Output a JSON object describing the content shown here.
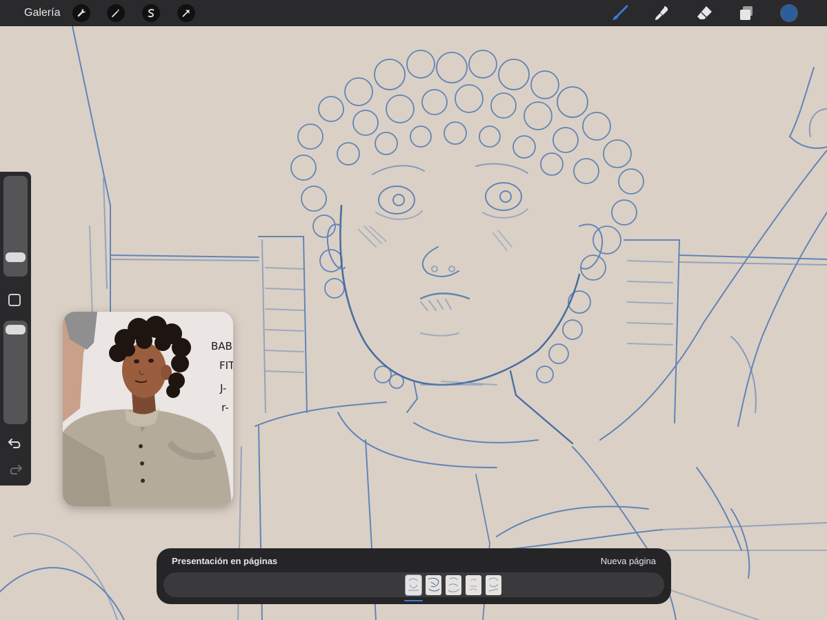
{
  "topbar": {
    "gallery_label": "Galería",
    "left_tools": [
      "wrench-icon",
      "magic-wand-icon",
      "selection-s-icon",
      "transform-arrow-icon"
    ],
    "right_tools": [
      "brush-icon",
      "smudge-icon",
      "eraser-icon",
      "layers-icon"
    ],
    "active_tool": "brush-icon",
    "current_color": "#2d5e9c"
  },
  "sidebar": {
    "brush_size_level": 0.3,
    "opacity_level": 0.95
  },
  "reference": {
    "text_lines": [
      "BAB",
      "FITT",
      "J-",
      "r-"
    ]
  },
  "pages": {
    "title": "Presentación en páginas",
    "new_page_label": "Nueva página",
    "thumbnail_count": 5,
    "active_index": 0
  },
  "colors": {
    "sketch": "#3a6aa8",
    "canvas": "#dbd0c6",
    "ui_dark": "#2a2a2c",
    "accent": "#3a7bd5"
  }
}
